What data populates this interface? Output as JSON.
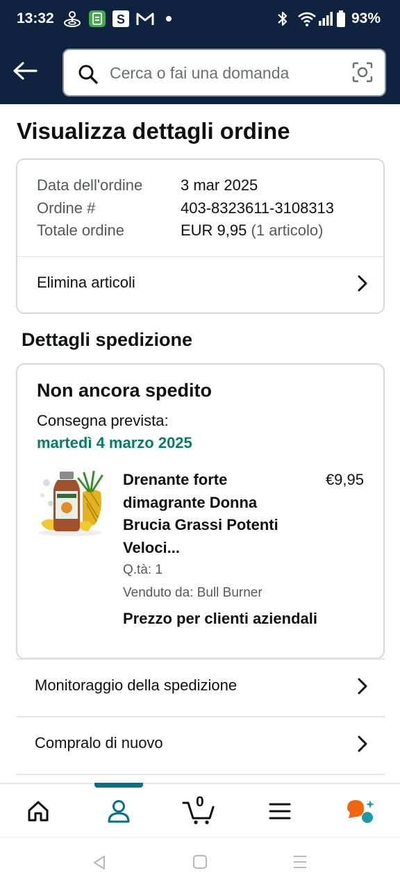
{
  "status_bar": {
    "time": "13:32",
    "battery": "93%",
    "icons": [
      "mirror-icon",
      "app-icon",
      "s-icon",
      "gmail-icon",
      "dot-icon",
      "bluetooth-icon",
      "wifi-icon",
      "signal-icon",
      "battery-icon"
    ]
  },
  "header": {
    "search_placeholder": "Cerca o fai una domanda",
    "colors": {
      "background": "#0f2340",
      "accent": "#007185",
      "delivery_green": "#067d62"
    }
  },
  "page": {
    "title": "Visualizza dettagli ordine"
  },
  "order_summary": {
    "rows": [
      {
        "label": "Data dell'ordine",
        "value": "3 mar 2025"
      },
      {
        "label": "Ordine #",
        "value": "403-8323611-3108313"
      },
      {
        "label": "Totale ordine",
        "value": "EUR 9,95",
        "extra": "(1 articolo)"
      }
    ],
    "delete_items_label": "Elimina articoli"
  },
  "shipping": {
    "section_title": "Dettagli spedizione",
    "status": "Non ancora spedito",
    "expected_label": "Consegna prevista:",
    "expected_date": "martedì 4 marzo 2025",
    "product": {
      "title": "Drenante forte dimagrante Donna Brucia Grassi Potenti Veloci...",
      "price": "€9,95",
      "quantity": "Q.tà: 1",
      "seller": "Venduto da: Bull Burner",
      "business_price": "Prezzo per clienti aziendali"
    }
  },
  "actions": [
    {
      "label": "Monitoraggio della spedizione"
    },
    {
      "label": "Compralo di nuovo"
    }
  ],
  "bottom_nav": {
    "items": [
      "home-icon",
      "account-icon",
      "cart-icon",
      "menu-icon",
      "rufus-icon"
    ],
    "cart_count": "0",
    "active": "account-icon"
  }
}
